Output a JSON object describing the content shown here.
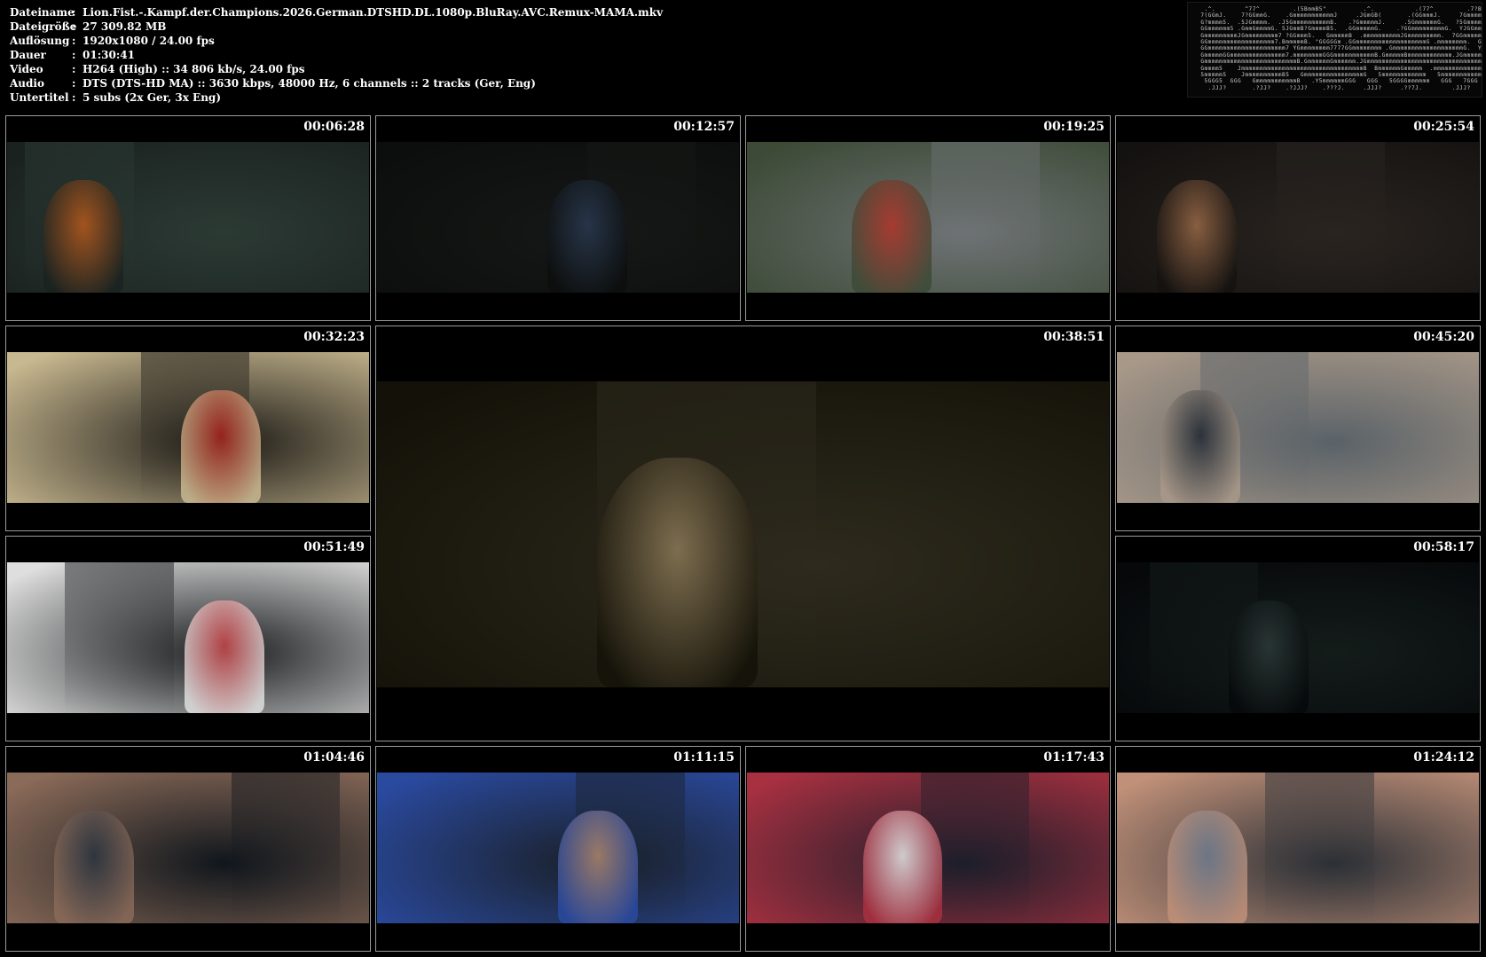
{
  "info": {
    "rows": [
      {
        "label": "Dateiname",
        "sep": ":",
        "value": "Lion.Fist.-.Kampf.der.Champions.2026.German.DTSHD.DL.1080p.BluRay.AVC.Remux-MAMA.mkv"
      },
      {
        "label": "Dateigröße",
        "sep": ":",
        "value": "27 309.82 MB"
      },
      {
        "label": "Auflösung",
        "sep": ":",
        "value": "1920x1080 / 24.00 fps"
      },
      {
        "label": "Dauer",
        "sep": ":",
        "value": "01:30:41"
      },
      {
        "label": "Video",
        "sep": ":",
        "value": "H264 (High) :: 34 806 kb/s, 24.00 fps"
      },
      {
        "label": "Audio",
        "sep": ":",
        "value": "DTS (DTS-HD MA) :: 3630 kbps, 48000 Hz, 6 channels :: 2 tracks (Ger, Eng)"
      },
      {
        "label": "Untertitel",
        "sep": ":",
        "value": "5 subs (2x Ger, 3x Eng)"
      }
    ]
  },
  "logo": {
    "icon": "mama-ascii-logo"
  },
  "thumbnails": [
    {
      "time": "00:06:28",
      "colors": [
        "#2c3a34",
        "#b85a1c",
        "#1a2220"
      ]
    },
    {
      "time": "00:12:57",
      "colors": [
        "#151816",
        "#2a3a52",
        "#0c0e0d"
      ]
    },
    {
      "time": "00:19:25",
      "colors": [
        "#6e7274",
        "#b23328",
        "#3c4a36"
      ]
    },
    {
      "time": "00:25:54",
      "colors": [
        "#2a2420",
        "#9a6a48",
        "#141210"
      ]
    },
    {
      "time": "00:32:23",
      "colors": [
        "#1c1a16",
        "#a8241c",
        "#c8b890"
      ]
    },
    {
      "time": "00:38:51",
      "colors": [
        "#2e2a1e",
        "#8c7a58",
        "#141208"
      ]
    },
    {
      "time": "00:45:20",
      "colors": [
        "#5a6268",
        "#1e2630",
        "#a89888"
      ]
    },
    {
      "time": "00:51:49",
      "colors": [
        "#1a1c1e",
        "#c8474a",
        "#dedede"
      ]
    },
    {
      "time": "00:58:17",
      "colors": [
        "#141c1a",
        "#2c3a38",
        "#06080a"
      ]
    },
    {
      "time": "01:04:46",
      "colors": [
        "#10161c",
        "#2a3440",
        "#8a6a58"
      ]
    },
    {
      "time": "01:11:15",
      "colors": [
        "#1a2028",
        "#b08870",
        "#2a4aa0"
      ]
    },
    {
      "time": "01:17:43",
      "colors": [
        "#1c1e2a",
        "#e8e8e8",
        "#a83040"
      ]
    },
    {
      "time": "01:24:12",
      "colors": [
        "#2c3036",
        "#6a7a8e",
        "#c09078"
      ]
    }
  ]
}
